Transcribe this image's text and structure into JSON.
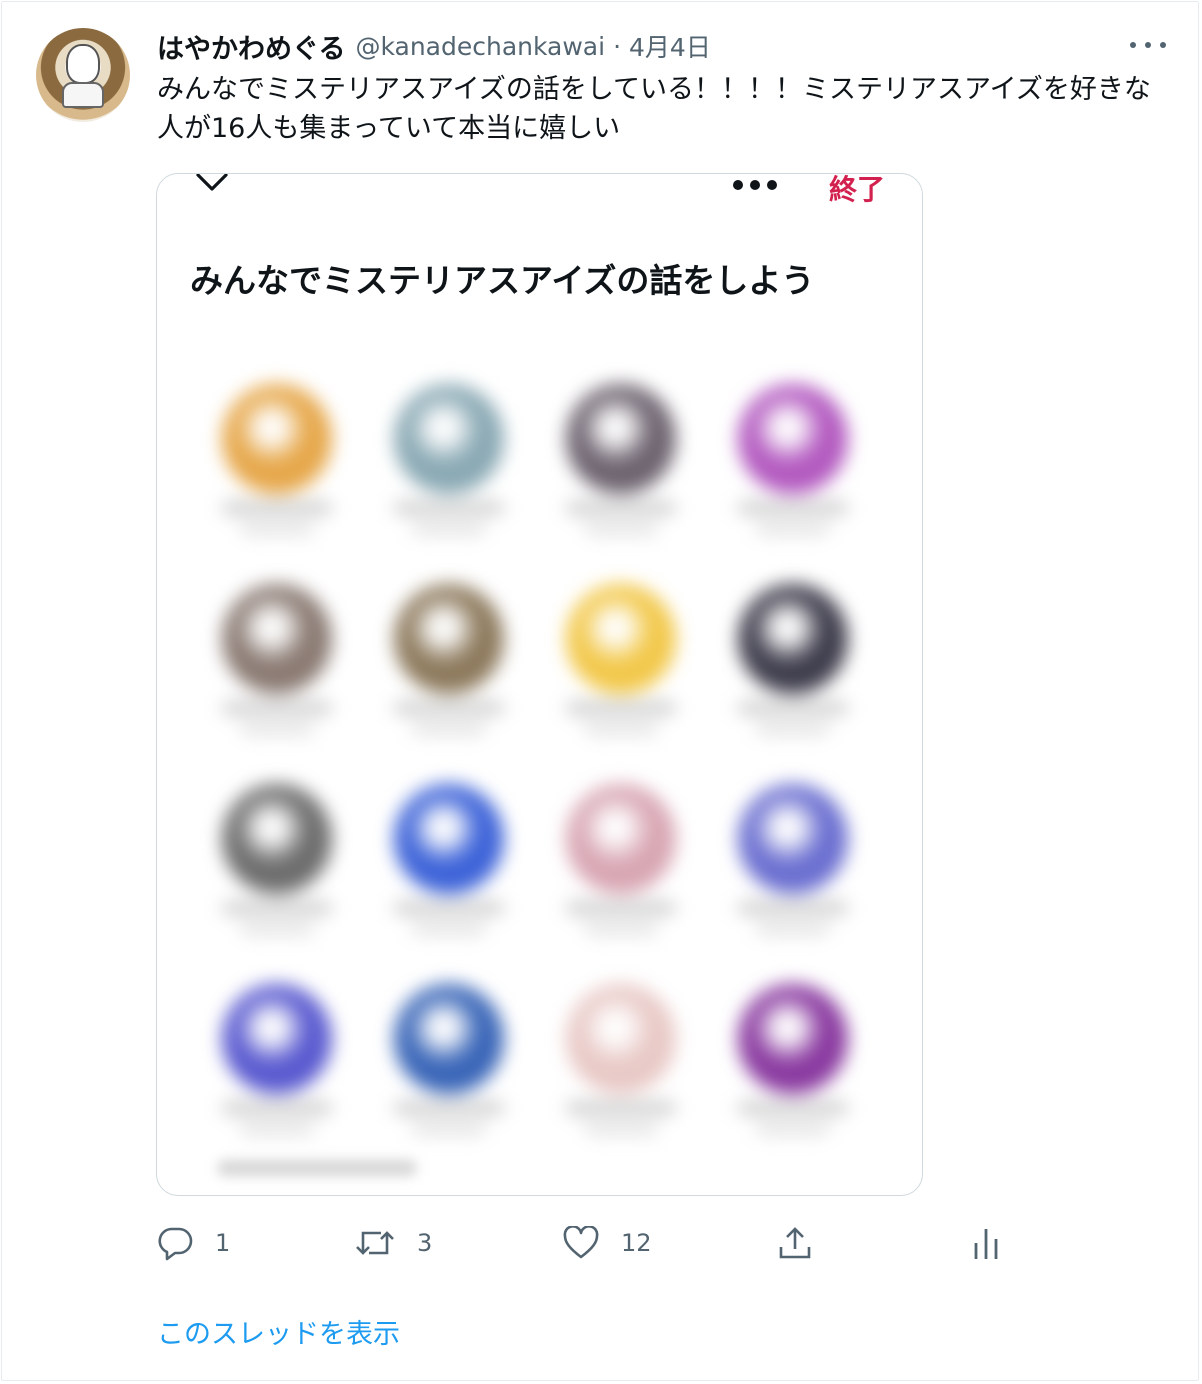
{
  "tweet": {
    "author_name": "はやかわめぐる",
    "handle": "@kanadechankawai",
    "separator": "·",
    "date": "4月4日",
    "text": "みんなでミステリアスアイズの話をしている！！！！ミステリアスアイズを好きな人が16人も集まっていて本当に嬉しい"
  },
  "card": {
    "end_label": "終了",
    "space_title": "みんなでミステリアスアイズの話をしよう",
    "participant_avatar_colors": [
      "#e6a74a",
      "#8aa9b4",
      "#6e6470",
      "#b35ac0",
      "#8a7a72",
      "#8d7a5d",
      "#f2c84b",
      "#3f3e4d",
      "#6d6d6d",
      "#3d63d8",
      "#d8a6b3",
      "#6b6fd0",
      "#5a5ad0",
      "#3a66b8",
      "#e8c9c6",
      "#8a3aa0"
    ]
  },
  "actions": {
    "reply_count": "1",
    "retweet_count": "3",
    "like_count": "12"
  },
  "icons": [
    "more-icon",
    "chevron-down-icon",
    "reply-icon",
    "retweet-icon",
    "like-icon",
    "share-icon",
    "analytics-icon"
  ],
  "thread_link": "このスレッドを表示",
  "colors": {
    "accent": "#1d9bf0",
    "end": "#d3214f",
    "muted": "#536471"
  }
}
